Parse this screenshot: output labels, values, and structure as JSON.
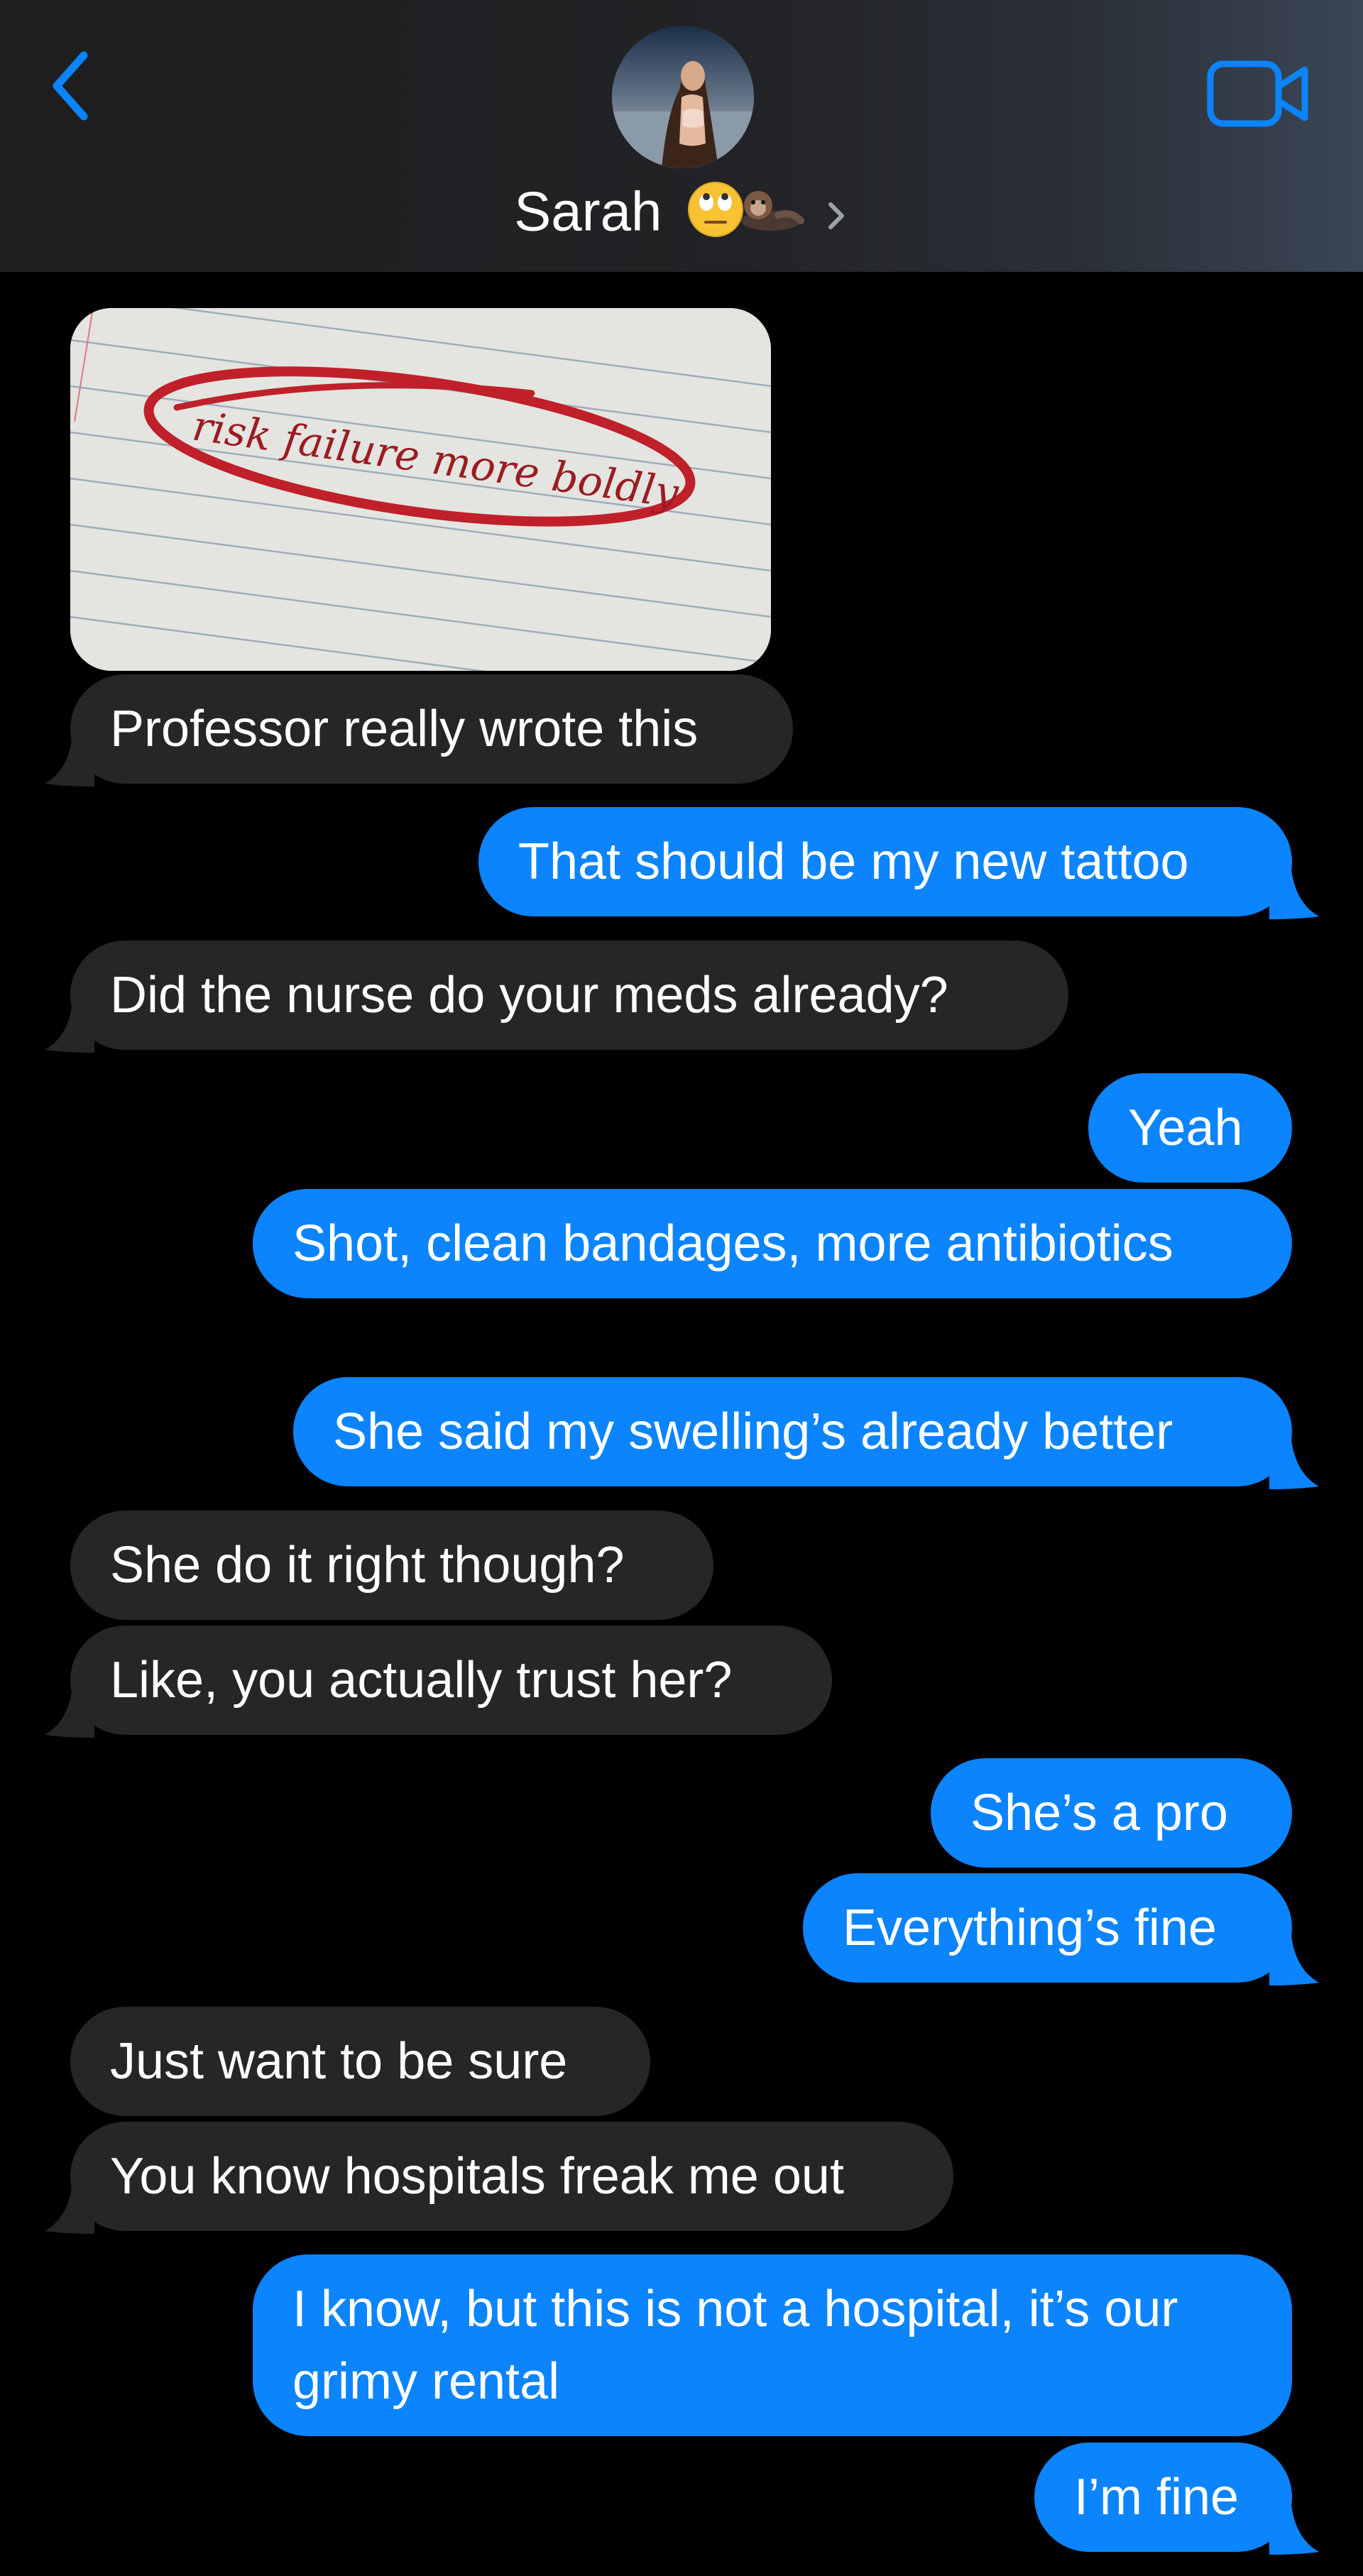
{
  "header": {
    "contact_name": "Sarah",
    "name_emoji": "🙄🦦",
    "icons": {
      "back": "chevron-left-icon",
      "video": "video-camera-icon",
      "disclosure": "chevron-right-icon"
    },
    "accent_color": "#0b84fe"
  },
  "conversation": {
    "photo": {
      "handwriting": "risk failure more boldly"
    },
    "messages": [
      {
        "from": "them",
        "text": "Professor really wrote this"
      },
      {
        "from": "me",
        "text": "That should be my new tattoo"
      },
      {
        "from": "them",
        "text": "Did the nurse do your meds already?"
      },
      {
        "from": "me",
        "text": "Yeah"
      },
      {
        "from": "me",
        "text": "Shot, clean bandages, more antibiotics"
      },
      {
        "from": "me",
        "text": "She said my swelling’s already better"
      },
      {
        "from": "them",
        "text": "She do it right though?"
      },
      {
        "from": "them",
        "text": "Like, you actually trust her?"
      },
      {
        "from": "me",
        "text": "She’s a pro"
      },
      {
        "from": "me",
        "text": "Everything’s fine"
      },
      {
        "from": "them",
        "text": "Just want to be sure"
      },
      {
        "from": "them",
        "text": "You know hospitals freak me out"
      },
      {
        "from": "me",
        "text": "I know, but this is not a hospital, it’s our grimy rental"
      },
      {
        "from": "me",
        "text": "I’m fine"
      }
    ],
    "colors": {
      "incoming_bubble": "#262629",
      "outgoing_bubble": "#0b84fe",
      "background": "#000000"
    }
  }
}
